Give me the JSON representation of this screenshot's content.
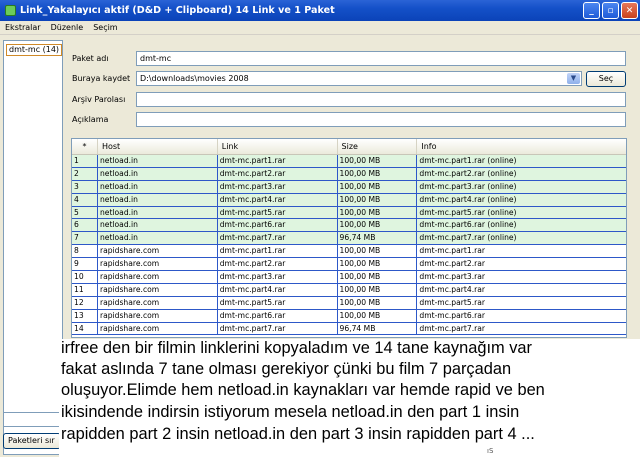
{
  "window": {
    "title": "Link_Yakalayıcı aktif (D&D + Clipboard) 14 Link ve 1 Paket",
    "buttons": {
      "minimize": "_",
      "maximize": "▫",
      "close": "✕"
    }
  },
  "menu": [
    "Ekstralar",
    "Düzenle",
    "Seçim"
  ],
  "left_panel": {
    "package_item": "dmt-mc (14)",
    "bottom_button": "Paketleri sır"
  },
  "form": {
    "package_name_label": "Paket adı",
    "package_name_value": "dmt-mc",
    "save_to_label": "Buraya kaydet",
    "save_to_value": "D:\\downloads\\movies 2008",
    "browse_button": "Seç",
    "archive_password_label": "Arşiv Parolası",
    "archive_password_value": "",
    "comment_label": "Açıklama",
    "comment_value": ""
  },
  "table": {
    "headers": [
      "*",
      "Host",
      "Link",
      "Size",
      "Info"
    ],
    "rows": [
      [
        "1",
        "netload.in",
        "dmt-mc.part1.rar",
        "100,00 MB",
        "dmt-mc.part1.rar (online)"
      ],
      [
        "2",
        "netload.in",
        "dmt-mc.part2.rar",
        "100,00 MB",
        "dmt-mc.part2.rar (online)"
      ],
      [
        "3",
        "netload.in",
        "dmt-mc.part3.rar",
        "100,00 MB",
        "dmt-mc.part3.rar (online)"
      ],
      [
        "4",
        "netload.in",
        "dmt-mc.part4.rar",
        "100,00 MB",
        "dmt-mc.part4.rar (online)"
      ],
      [
        "5",
        "netload.in",
        "dmt-mc.part5.rar",
        "100,00 MB",
        "dmt-mc.part5.rar (online)"
      ],
      [
        "6",
        "netload.in",
        "dmt-mc.part6.rar",
        "100,00 MB",
        "dmt-mc.part6.rar (online)"
      ],
      [
        "7",
        "netload.in",
        "dmt-mc.part7.rar",
        "96,74 MB",
        "dmt-mc.part7.rar (online)"
      ],
      [
        "8",
        "rapidshare.com",
        "dmt-mc.part1.rar",
        "100,00 MB",
        "dmt-mc.part1.rar"
      ],
      [
        "9",
        "rapidshare.com",
        "dmt-mc.part2.rar",
        "100,00 MB",
        "dmt-mc.part2.rar"
      ],
      [
        "10",
        "rapidshare.com",
        "dmt-mc.part3.rar",
        "100,00 MB",
        "dmt-mc.part3.rar"
      ],
      [
        "11",
        "rapidshare.com",
        "dmt-mc.part4.rar",
        "100,00 MB",
        "dmt-mc.part4.rar"
      ],
      [
        "12",
        "rapidshare.com",
        "dmt-mc.part5.rar",
        "100,00 MB",
        "dmt-mc.part5.rar"
      ],
      [
        "13",
        "rapidshare.com",
        "dmt-mc.part6.rar",
        "100,00 MB",
        "dmt-mc.part6.rar"
      ],
      [
        "14",
        "rapidshare.com",
        "dmt-mc.part7.rar",
        "96,74 MB",
        "dmt-mc.part7.rar"
      ]
    ],
    "online_row_color": "#dff5df",
    "row_border_color": "#2d58c8"
  },
  "overlay_text": [
    "irfree den bir filmin linklerini kopyaladım ve 14 tane kaynağım var",
    "fakat aslında 7 tane olması gerekiyor çünki bu film 7 parçadan",
    "oluşuyor.Elimde hem netload.in kaynakları var hemde rapid ve ben",
    "ikisindende indirsin istiyorum mesela netload.in den part 1 insin",
    "rapidden part 2 insin netload.in den part 3 insin rapidden part 4 ..."
  ],
  "overlay_tail": "ıS"
}
